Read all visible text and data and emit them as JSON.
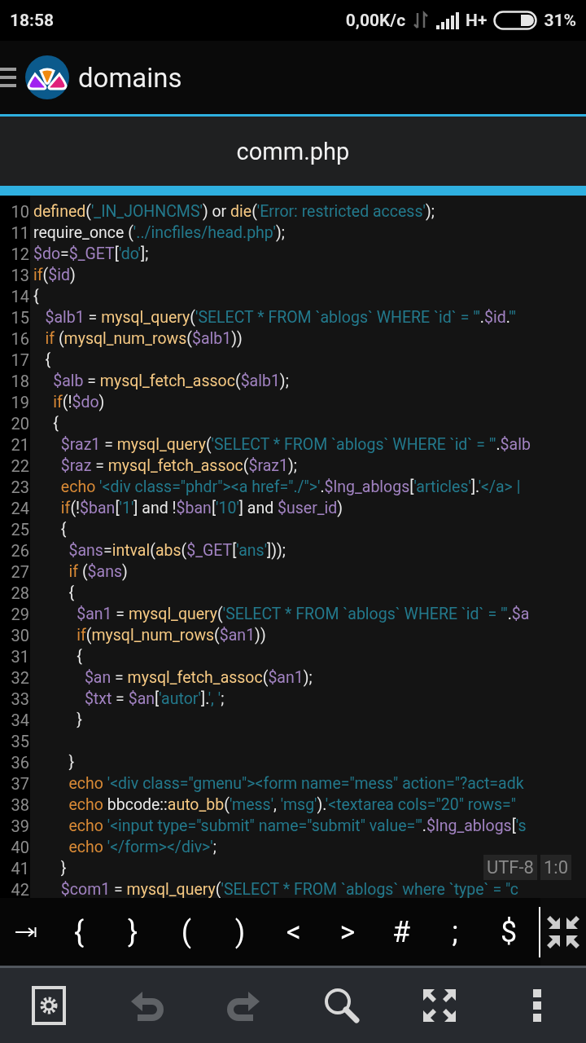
{
  "status_bar": {
    "time": "18:58",
    "speed": "0,00K/c",
    "network": "H+",
    "battery": "31%"
  },
  "app_bar": {
    "title": "domains"
  },
  "file_tab": {
    "title": "comm.php"
  },
  "editor": {
    "lines": [
      {
        "number": "10",
        "tokens": [
          {
            "kind": "fn",
            "text": "defined"
          },
          {
            "kind": "plain",
            "text": "("
          },
          {
            "kind": "str",
            "text": "'_IN_JOHNCMS'"
          },
          {
            "kind": "plain",
            "text": ") or "
          },
          {
            "kind": "fn",
            "text": "die"
          },
          {
            "kind": "plain",
            "text": "("
          },
          {
            "kind": "str",
            "text": "'Error: restricted access'"
          },
          {
            "kind": "plain",
            "text": ");"
          }
        ]
      },
      {
        "number": "11",
        "tokens": [
          {
            "kind": "plain",
            "text": "require_once ("
          },
          {
            "kind": "str",
            "text": "'../incfiles/head.php'"
          },
          {
            "kind": "plain",
            "text": ");"
          }
        ]
      },
      {
        "number": "12",
        "tokens": [
          {
            "kind": "var",
            "text": "$do"
          },
          {
            "kind": "plain",
            "text": "="
          },
          {
            "kind": "var",
            "text": "$_GET"
          },
          {
            "kind": "plain",
            "text": "["
          },
          {
            "kind": "str",
            "text": "'do'"
          },
          {
            "kind": "plain",
            "text": "];"
          }
        ]
      },
      {
        "number": "13",
        "tokens": [
          {
            "kind": "kw",
            "text": "if"
          },
          {
            "kind": "plain",
            "text": "("
          },
          {
            "kind": "var",
            "text": "$id"
          },
          {
            "kind": "plain",
            "text": ")"
          }
        ]
      },
      {
        "number": "14",
        "tokens": [
          {
            "kind": "plain",
            "text": "{"
          }
        ]
      },
      {
        "number": "15",
        "tokens": [
          {
            "kind": "var",
            "text": "   $alb1"
          },
          {
            "kind": "plain",
            "text": " = "
          },
          {
            "kind": "fn",
            "text": "mysql_query"
          },
          {
            "kind": "plain",
            "text": "("
          },
          {
            "kind": "str",
            "text": "'SELECT * FROM `ablogs` WHERE `id` = \"'"
          },
          {
            "kind": "plain",
            "text": "."
          },
          {
            "kind": "var",
            "text": "$id"
          },
          {
            "kind": "plain",
            "text": "."
          },
          {
            "kind": "str",
            "text": "'\""
          }
        ]
      },
      {
        "number": "16",
        "tokens": [
          {
            "kind": "kw",
            "text": "   if"
          },
          {
            "kind": "plain",
            "text": " ("
          },
          {
            "kind": "fn",
            "text": "mysql_num_rows"
          },
          {
            "kind": "plain",
            "text": "("
          },
          {
            "kind": "var",
            "text": "$alb1"
          },
          {
            "kind": "plain",
            "text": "))"
          }
        ]
      },
      {
        "number": "17",
        "tokens": [
          {
            "kind": "plain",
            "text": "   {"
          }
        ]
      },
      {
        "number": "18",
        "tokens": [
          {
            "kind": "var",
            "text": "     $alb"
          },
          {
            "kind": "plain",
            "text": " = "
          },
          {
            "kind": "fn",
            "text": "mysql_fetch_assoc"
          },
          {
            "kind": "plain",
            "text": "("
          },
          {
            "kind": "var",
            "text": "$alb1"
          },
          {
            "kind": "plain",
            "text": ");"
          }
        ]
      },
      {
        "number": "19",
        "tokens": [
          {
            "kind": "kw",
            "text": "     if"
          },
          {
            "kind": "plain",
            "text": "(!"
          },
          {
            "kind": "var",
            "text": "$do"
          },
          {
            "kind": "plain",
            "text": ")"
          }
        ]
      },
      {
        "number": "20",
        "tokens": [
          {
            "kind": "plain",
            "text": "     {"
          }
        ]
      },
      {
        "number": "21",
        "tokens": [
          {
            "kind": "var",
            "text": "       $raz1"
          },
          {
            "kind": "plain",
            "text": " = "
          },
          {
            "kind": "fn",
            "text": "mysql_query"
          },
          {
            "kind": "plain",
            "text": "("
          },
          {
            "kind": "str",
            "text": "'SELECT * FROM `ablogs` WHERE `id` = \"'"
          },
          {
            "kind": "plain",
            "text": "."
          },
          {
            "kind": "var",
            "text": "$alb"
          }
        ]
      },
      {
        "number": "22",
        "tokens": [
          {
            "kind": "var",
            "text": "       $raz"
          },
          {
            "kind": "plain",
            "text": " = "
          },
          {
            "kind": "fn",
            "text": "mysql_fetch_assoc"
          },
          {
            "kind": "plain",
            "text": "("
          },
          {
            "kind": "var",
            "text": "$raz1"
          },
          {
            "kind": "plain",
            "text": ");"
          }
        ]
      },
      {
        "number": "23",
        "tokens": [
          {
            "kind": "kw",
            "text": "       echo"
          },
          {
            "kind": "str",
            "text": " '<div class=\"phdr\"><a href=\"./\">'"
          },
          {
            "kind": "plain",
            "text": "."
          },
          {
            "kind": "var",
            "text": "$lng_ablogs"
          },
          {
            "kind": "plain",
            "text": "["
          },
          {
            "kind": "str",
            "text": "'articles'"
          },
          {
            "kind": "plain",
            "text": "]."
          },
          {
            "kind": "str",
            "text": "'</a> |"
          }
        ]
      },
      {
        "number": "24",
        "tokens": [
          {
            "kind": "kw",
            "text": "       if"
          },
          {
            "kind": "plain",
            "text": "(!"
          },
          {
            "kind": "var",
            "text": "$ban"
          },
          {
            "kind": "plain",
            "text": "["
          },
          {
            "kind": "str",
            "text": "'1'"
          },
          {
            "kind": "plain",
            "text": "] and !"
          },
          {
            "kind": "var",
            "text": "$ban"
          },
          {
            "kind": "plain",
            "text": "["
          },
          {
            "kind": "str",
            "text": "'10'"
          },
          {
            "kind": "plain",
            "text": "] and "
          },
          {
            "kind": "var",
            "text": "$user_id"
          },
          {
            "kind": "plain",
            "text": ")"
          }
        ]
      },
      {
        "number": "25",
        "tokens": [
          {
            "kind": "plain",
            "text": "       {"
          }
        ]
      },
      {
        "number": "26",
        "tokens": [
          {
            "kind": "var",
            "text": "         $ans"
          },
          {
            "kind": "plain",
            "text": "="
          },
          {
            "kind": "fn",
            "text": "intval"
          },
          {
            "kind": "plain",
            "text": "("
          },
          {
            "kind": "fn",
            "text": "abs"
          },
          {
            "kind": "plain",
            "text": "("
          },
          {
            "kind": "var",
            "text": "$_GET"
          },
          {
            "kind": "plain",
            "text": "["
          },
          {
            "kind": "str",
            "text": "'ans'"
          },
          {
            "kind": "plain",
            "text": "]));"
          }
        ]
      },
      {
        "number": "27",
        "tokens": [
          {
            "kind": "kw",
            "text": "         if"
          },
          {
            "kind": "plain",
            "text": " ("
          },
          {
            "kind": "var",
            "text": "$ans"
          },
          {
            "kind": "plain",
            "text": ")"
          }
        ]
      },
      {
        "number": "28",
        "tokens": [
          {
            "kind": "plain",
            "text": "         {"
          }
        ]
      },
      {
        "number": "29",
        "tokens": [
          {
            "kind": "var",
            "text": "           $an1"
          },
          {
            "kind": "plain",
            "text": " = "
          },
          {
            "kind": "fn",
            "text": "mysql_query"
          },
          {
            "kind": "plain",
            "text": "("
          },
          {
            "kind": "str",
            "text": "'SELECT * FROM `ablogs` WHERE `id` = \"'"
          },
          {
            "kind": "plain",
            "text": "."
          },
          {
            "kind": "var",
            "text": "$a"
          }
        ]
      },
      {
        "number": "30",
        "tokens": [
          {
            "kind": "kw",
            "text": "           if"
          },
          {
            "kind": "plain",
            "text": "("
          },
          {
            "kind": "fn",
            "text": "mysql_num_rows"
          },
          {
            "kind": "plain",
            "text": "("
          },
          {
            "kind": "var",
            "text": "$an1"
          },
          {
            "kind": "plain",
            "text": "))"
          }
        ]
      },
      {
        "number": "31",
        "tokens": [
          {
            "kind": "plain",
            "text": "           {"
          }
        ]
      },
      {
        "number": "32",
        "tokens": [
          {
            "kind": "var",
            "text": "             $an"
          },
          {
            "kind": "plain",
            "text": " = "
          },
          {
            "kind": "fn",
            "text": "mysql_fetch_assoc"
          },
          {
            "kind": "plain",
            "text": "("
          },
          {
            "kind": "var",
            "text": "$an1"
          },
          {
            "kind": "plain",
            "text": ");"
          }
        ]
      },
      {
        "number": "33",
        "tokens": [
          {
            "kind": "var",
            "text": "             $txt"
          },
          {
            "kind": "plain",
            "text": " = "
          },
          {
            "kind": "var",
            "text": "$an"
          },
          {
            "kind": "plain",
            "text": "["
          },
          {
            "kind": "str",
            "text": "'autor'"
          },
          {
            "kind": "plain",
            "text": "]."
          },
          {
            "kind": "str",
            "text": "', '"
          },
          {
            "kind": "plain",
            "text": ";"
          }
        ]
      },
      {
        "number": "34",
        "tokens": [
          {
            "kind": "plain",
            "text": "           }"
          }
        ]
      },
      {
        "number": "35"
      },
      {
        "number": "36",
        "tokens": [
          {
            "kind": "plain",
            "text": "         }"
          }
        ]
      },
      {
        "number": "37",
        "tokens": [
          {
            "kind": "kw",
            "text": "         echo"
          },
          {
            "kind": "str",
            "text": " '<div class=\"gmenu\"><form name=\"mess\" action=\"?act=adk"
          }
        ]
      },
      {
        "number": "38",
        "tokens": [
          {
            "kind": "kw",
            "text": "         echo"
          },
          {
            "kind": "plain",
            "text": " bbcode::"
          },
          {
            "kind": "fn",
            "text": "auto_bb"
          },
          {
            "kind": "plain",
            "text": "("
          },
          {
            "kind": "str",
            "text": "'mess'"
          },
          {
            "kind": "plain",
            "text": ", "
          },
          {
            "kind": "str",
            "text": "'msg'"
          },
          {
            "kind": "plain",
            "text": ")."
          },
          {
            "kind": "str",
            "text": "'<textarea cols=\"20\" rows=\""
          }
        ]
      },
      {
        "number": "39",
        "tokens": [
          {
            "kind": "kw",
            "text": "         echo"
          },
          {
            "kind": "str",
            "text": " '<input type=\"submit\" name=\"submit\" value=\"'"
          },
          {
            "kind": "plain",
            "text": "."
          },
          {
            "kind": "var",
            "text": "$lng_ablogs"
          },
          {
            "kind": "plain",
            "text": "["
          },
          {
            "kind": "str",
            "text": "'s"
          }
        ]
      },
      {
        "number": "40",
        "tokens": [
          {
            "kind": "kw",
            "text": "         echo"
          },
          {
            "kind": "str",
            "text": " '</form></div>'"
          },
          {
            "kind": "plain",
            "text": ";"
          }
        ]
      },
      {
        "number": "41",
        "tokens": [
          {
            "kind": "plain",
            "text": "       }"
          }
        ]
      },
      {
        "number": "42",
        "tokens": [
          {
            "kind": "var",
            "text": "       $com1"
          },
          {
            "kind": "plain",
            "text": " = "
          },
          {
            "kind": "fn",
            "text": "mysql_query"
          },
          {
            "kind": "plain",
            "text": "("
          },
          {
            "kind": "str",
            "text": "'SELECT * FROM `ablogs` where `type` = \"c"
          }
        ]
      }
    ],
    "encoding": "UTF-8",
    "cursor": "1:0"
  },
  "symbol_bar": {
    "keys": [
      "{",
      "}",
      "(",
      ")",
      "<",
      ">",
      "#",
      ";",
      "$"
    ]
  },
  "toolbar": [
    {
      "kind": "settings",
      "disabled": false
    },
    {
      "kind": "undo",
      "disabled": true
    },
    {
      "kind": "redo",
      "disabled": true
    },
    {
      "kind": "search",
      "disabled": false
    },
    {
      "kind": "fullscreen",
      "disabled": false
    },
    {
      "kind": "more",
      "disabled": false
    }
  ]
}
